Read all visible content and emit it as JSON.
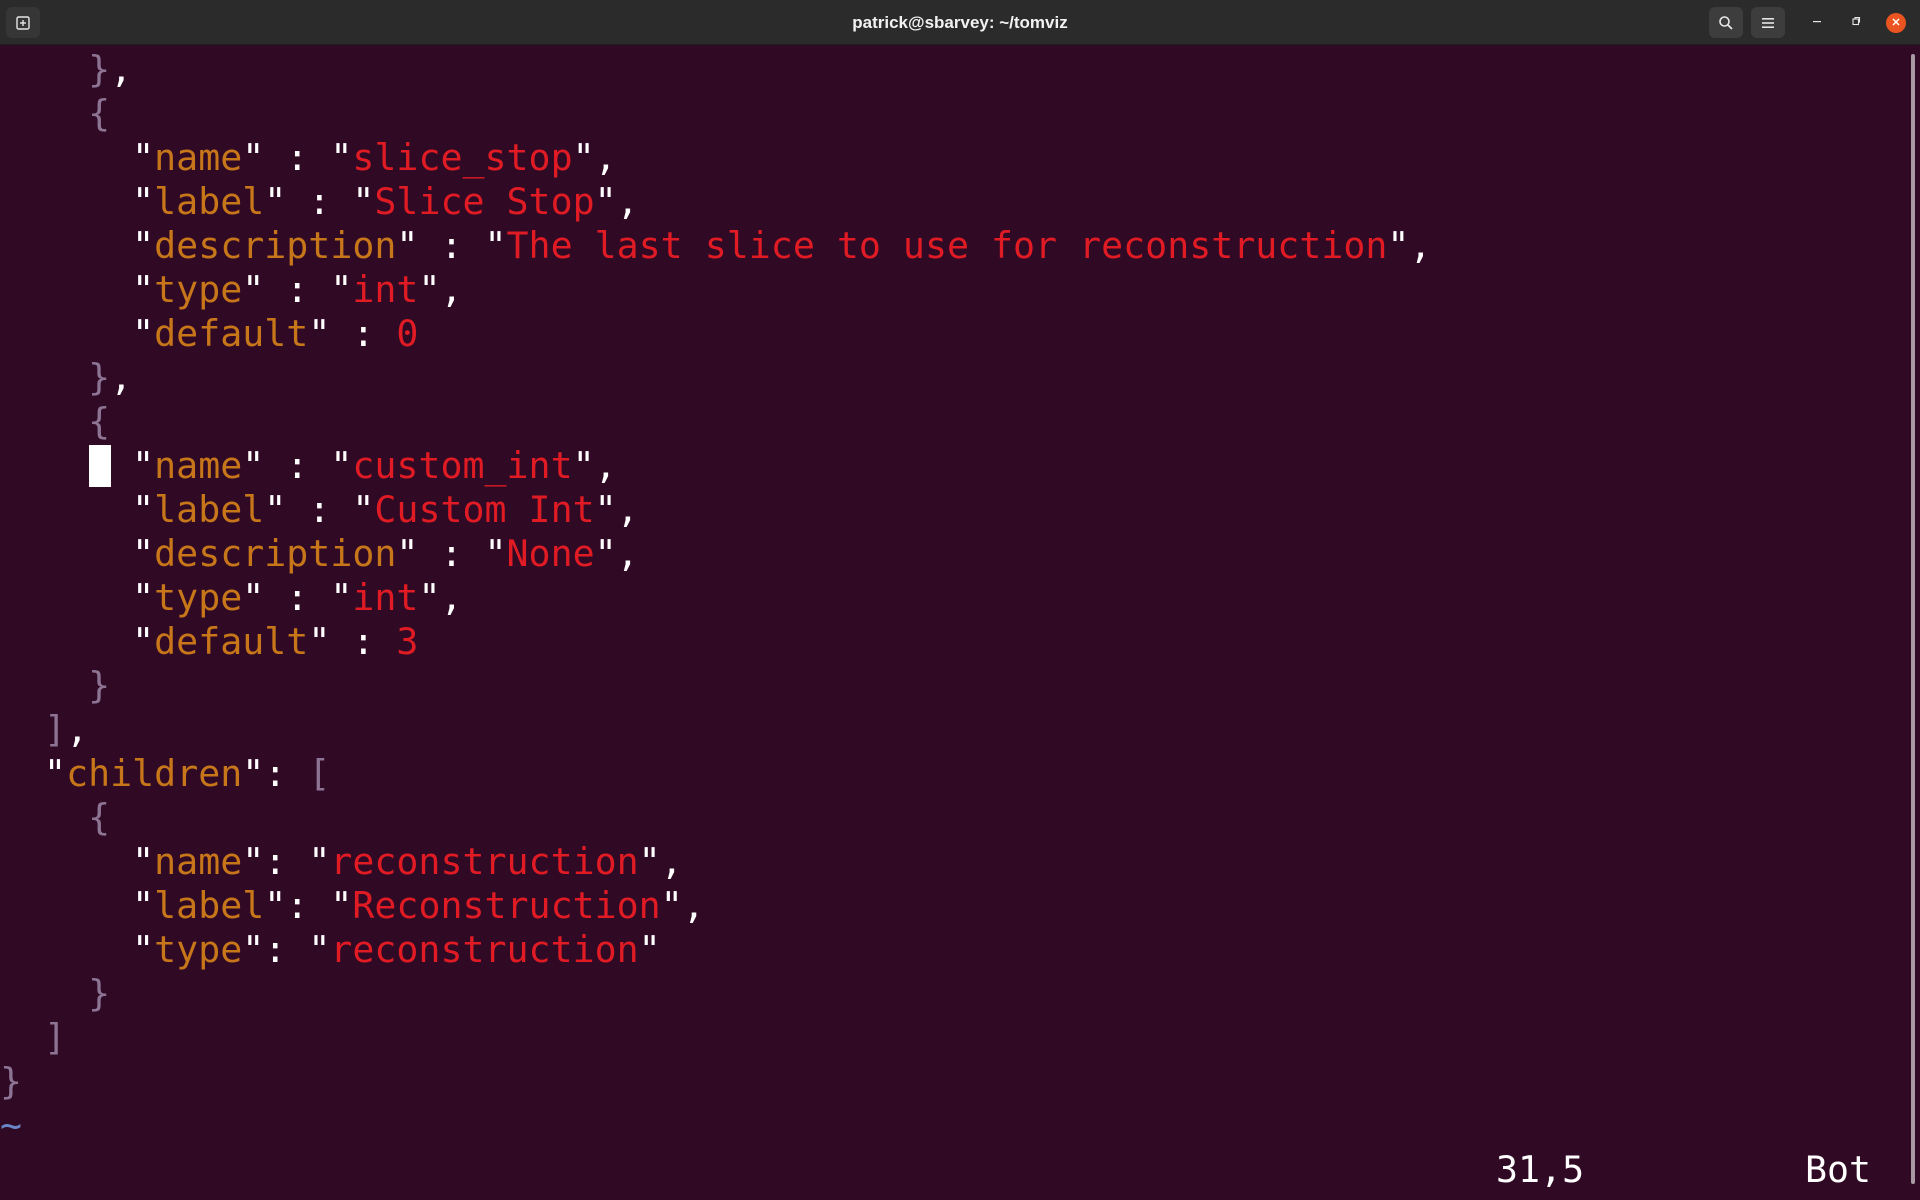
{
  "window": {
    "title": "patrick@sbarvey: ~/tomviz"
  },
  "titlebar_icons": {
    "new_tab": "new-tab-icon",
    "search": "search-icon",
    "menu": "hamburger-menu-icon",
    "minimize": "minimize-icon",
    "maximize": "maximize-icon",
    "close": "close-icon"
  },
  "editor": {
    "lines": [
      [
        {
          "t": "    ",
          "c": "w"
        },
        {
          "t": "}",
          "c": "b"
        },
        {
          "t": ",",
          "c": "w"
        }
      ],
      [
        {
          "t": "    ",
          "c": "w"
        },
        {
          "t": "{",
          "c": "b"
        }
      ],
      [
        {
          "t": "      \"",
          "c": "w"
        },
        {
          "t": "name",
          "c": "k"
        },
        {
          "t": "\" : \"",
          "c": "w"
        },
        {
          "t": "slice_stop",
          "c": "s"
        },
        {
          "t": "\",",
          "c": "w"
        }
      ],
      [
        {
          "t": "      \"",
          "c": "w"
        },
        {
          "t": "label",
          "c": "k"
        },
        {
          "t": "\" : \"",
          "c": "w"
        },
        {
          "t": "Slice Stop",
          "c": "s"
        },
        {
          "t": "\",",
          "c": "w"
        }
      ],
      [
        {
          "t": "      \"",
          "c": "w"
        },
        {
          "t": "description",
          "c": "k"
        },
        {
          "t": "\" : \"",
          "c": "w"
        },
        {
          "t": "The last slice to use for reconstruction",
          "c": "s"
        },
        {
          "t": "\",",
          "c": "w"
        }
      ],
      [
        {
          "t": "      \"",
          "c": "w"
        },
        {
          "t": "type",
          "c": "k"
        },
        {
          "t": "\" : \"",
          "c": "w"
        },
        {
          "t": "int",
          "c": "s"
        },
        {
          "t": "\",",
          "c": "w"
        }
      ],
      [
        {
          "t": "      \"",
          "c": "w"
        },
        {
          "t": "default",
          "c": "k"
        },
        {
          "t": "\" : ",
          "c": "w"
        },
        {
          "t": "0",
          "c": "n"
        }
      ],
      [
        {
          "t": "    ",
          "c": "w"
        },
        {
          "t": "}",
          "c": "b"
        },
        {
          "t": ",",
          "c": "w"
        }
      ],
      [
        {
          "t": "    ",
          "c": "w"
        },
        {
          "t": "{",
          "c": "b"
        }
      ],
      [
        {
          "t": "      \"",
          "c": "w"
        },
        {
          "t": "name",
          "c": "k"
        },
        {
          "t": "\" : \"",
          "c": "w"
        },
        {
          "t": "custom_int",
          "c": "s"
        },
        {
          "t": "\",",
          "c": "w"
        }
      ],
      [
        {
          "t": "      \"",
          "c": "w"
        },
        {
          "t": "label",
          "c": "k"
        },
        {
          "t": "\" : \"",
          "c": "w"
        },
        {
          "t": "Custom Int",
          "c": "s"
        },
        {
          "t": "\",",
          "c": "w"
        }
      ],
      [
        {
          "t": "      \"",
          "c": "w"
        },
        {
          "t": "description",
          "c": "k"
        },
        {
          "t": "\" : \"",
          "c": "w"
        },
        {
          "t": "None",
          "c": "s"
        },
        {
          "t": "\",",
          "c": "w"
        }
      ],
      [
        {
          "t": "      \"",
          "c": "w"
        },
        {
          "t": "type",
          "c": "k"
        },
        {
          "t": "\" : \"",
          "c": "w"
        },
        {
          "t": "int",
          "c": "s"
        },
        {
          "t": "\",",
          "c": "w"
        }
      ],
      [
        {
          "t": "      \"",
          "c": "w"
        },
        {
          "t": "default",
          "c": "k"
        },
        {
          "t": "\" : ",
          "c": "w"
        },
        {
          "t": "3",
          "c": "n"
        }
      ],
      [
        {
          "t": "    ",
          "c": "w"
        },
        {
          "t": "}",
          "c": "b"
        }
      ],
      [
        {
          "t": "  ",
          "c": "w"
        },
        {
          "t": "]",
          "c": "b"
        },
        {
          "t": ",",
          "c": "w"
        }
      ],
      [
        {
          "t": "  \"",
          "c": "w"
        },
        {
          "t": "children",
          "c": "k"
        },
        {
          "t": "\": ",
          "c": "w"
        },
        {
          "t": "[",
          "c": "b"
        }
      ],
      [
        {
          "t": "    ",
          "c": "w"
        },
        {
          "t": "{",
          "c": "b"
        }
      ],
      [
        {
          "t": "      \"",
          "c": "w"
        },
        {
          "t": "name",
          "c": "k"
        },
        {
          "t": "\": \"",
          "c": "w"
        },
        {
          "t": "reconstruction",
          "c": "s"
        },
        {
          "t": "\",",
          "c": "w"
        }
      ],
      [
        {
          "t": "      \"",
          "c": "w"
        },
        {
          "t": "label",
          "c": "k"
        },
        {
          "t": "\": \"",
          "c": "w"
        },
        {
          "t": "Reconstruction",
          "c": "s"
        },
        {
          "t": "\",",
          "c": "w"
        }
      ],
      [
        {
          "t": "      \"",
          "c": "w"
        },
        {
          "t": "type",
          "c": "k"
        },
        {
          "t": "\": \"",
          "c": "w"
        },
        {
          "t": "reconstruction",
          "c": "s"
        },
        {
          "t": "\"",
          "c": "w"
        }
      ],
      [
        {
          "t": "    ",
          "c": "w"
        },
        {
          "t": "}",
          "c": "b"
        }
      ],
      [
        {
          "t": "  ",
          "c": "w"
        },
        {
          "t": "]",
          "c": "b"
        }
      ],
      [
        {
          "t": "}",
          "c": "b"
        }
      ],
      [
        {
          "t": "~",
          "c": "tilde"
        }
      ]
    ]
  },
  "statusline": {
    "position": "31,5",
    "scroll": "Bot"
  },
  "colors": {
    "background": "#300a24",
    "key": "#c7761a",
    "string": "#e01b24",
    "bracket": "#8e7494",
    "close_button": "#e95420"
  }
}
